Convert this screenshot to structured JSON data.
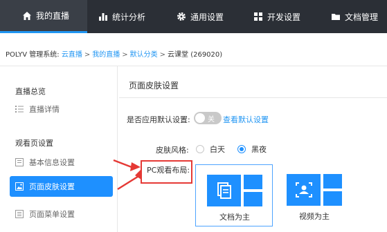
{
  "nav": {
    "items": [
      {
        "label": "我的直播",
        "icon": "home-icon",
        "active": true
      },
      {
        "label": "统计分析",
        "icon": "bar-chart-icon",
        "active": false
      },
      {
        "label": "通用设置",
        "icon": "gear-icon",
        "active": false
      },
      {
        "label": "开发设置",
        "icon": "grid-icon",
        "active": false
      },
      {
        "label": "文档管理",
        "icon": "folder-icon",
        "active": false
      }
    ]
  },
  "breadcrumb": {
    "prefix": "POLYV 管理系统:",
    "links": [
      "云直播",
      "我的直播",
      "默认分类"
    ],
    "sep": ">",
    "current": "云课堂 (269020)"
  },
  "sidebar": {
    "group1": "直播总览",
    "item_detail": "直播详情",
    "group2": "观看页设置",
    "item_basic": "基本信息设置",
    "item_skin": "页面皮肤设置",
    "item_menu": "页面菜单设置"
  },
  "main": {
    "title": "页面皮肤设置",
    "default_label": "是否应用默认设置:",
    "toggle_text": "关",
    "toggle_on": false,
    "view_default_link": "查看默认设置",
    "skin_label": "皮肤风格:",
    "skin_options": [
      "白天",
      "黑夜"
    ],
    "skin_selected": "黑夜",
    "layout_label": "PC观看布局:",
    "layout_options": [
      "文档为主",
      "视频为主"
    ],
    "layout_selected": "文档为主"
  },
  "colors": {
    "accent": "#1e90ff",
    "nav_bg": "#2b2f36",
    "highlight": "#e53935"
  }
}
